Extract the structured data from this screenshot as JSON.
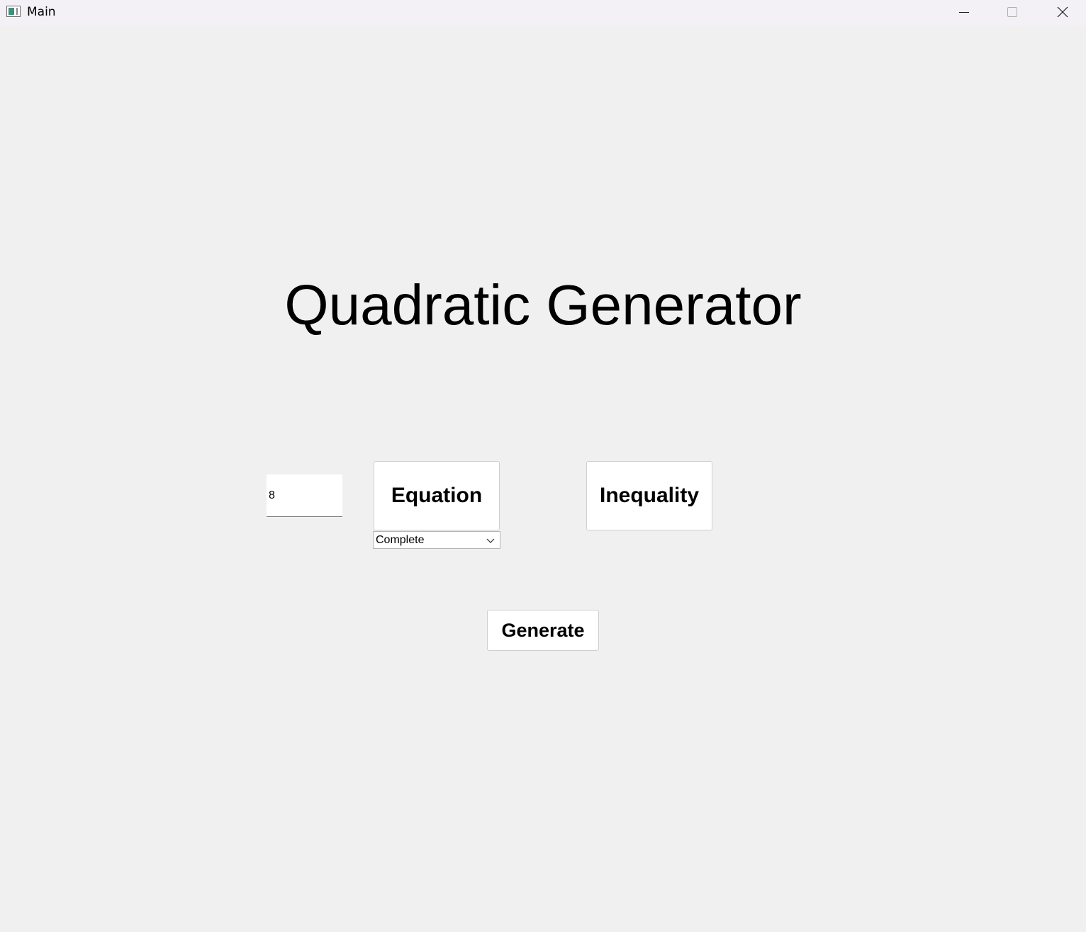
{
  "window": {
    "title": "Main",
    "controls": {
      "minimize_icon": "minimize-icon",
      "maximize_icon": "maximize-icon",
      "close_icon": "close-icon"
    }
  },
  "main": {
    "heading": "Quadratic Generator",
    "count_input": {
      "value": "8"
    },
    "equation_button": "Equation",
    "inequality_button": "Inequality",
    "type_select": {
      "selected": "Complete"
    },
    "generate_button": "Generate"
  },
  "colors": {
    "background": "#f0f0f0",
    "titlebar": "#f3f1f6",
    "button_bg": "#ffffff",
    "text": "#000000"
  }
}
